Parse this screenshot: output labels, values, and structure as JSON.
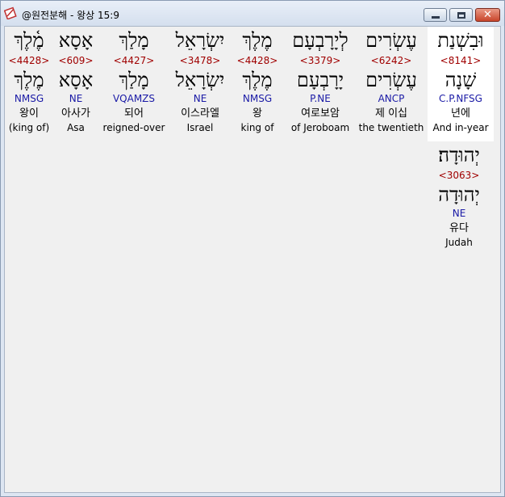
{
  "window": {
    "title": "@원전분해 - 왕상 15:9",
    "icon": "bible-app-icon"
  },
  "words": [
    {
      "surface": "מֶ֫לֶךְ",
      "strong": "<4428>",
      "lemma": "מֶלֶךְ",
      "parse": "NMSG",
      "korean": "왕이",
      "english": "(king of)"
    },
    {
      "surface": "אָסָא",
      "strong": "<609>",
      "lemma": "אָסָא",
      "parse": "NE",
      "korean": "아사가",
      "english": "Asa"
    },
    {
      "surface": "מָלַךְ",
      "strong": "<4427>",
      "lemma": "מָלַךְ",
      "parse": "VQAMZS",
      "korean": "되어",
      "english": "reigned-over"
    },
    {
      "surface": "יִשְׂרָאֵל",
      "strong": "<3478>",
      "lemma": "יִשְׂרָאֵל",
      "parse": "NE",
      "korean": "이스라엘",
      "english": "Israel"
    },
    {
      "surface": "מֶלֶךְ",
      "strong": "<4428>",
      "lemma": "מֶלֶךְ",
      "parse": "NMSG",
      "korean": "왕",
      "english": "king of"
    },
    {
      "surface": "לְיָרָבְעָם",
      "strong": "<3379>",
      "lemma": "יָרָבְעָם",
      "parse": "P.NE",
      "korean": "여로보암",
      "english": "of Jeroboam"
    },
    {
      "surface": "עֶשְׂרִים",
      "strong": "<6242>",
      "lemma": "עֶשְׂרִים",
      "parse": "ANCP",
      "korean": "제 이십",
      "english": "the twentieth"
    },
    {
      "surface": "וּבִשְׁנַת",
      "strong": "<8141>",
      "lemma": "שָׁנָה",
      "parse": "C.P.NFSG",
      "korean": "년에",
      "english": "And in-year"
    },
    {
      "surface": "יְהוּדָה׃",
      "strong": "<3063>",
      "lemma": "יְהוּדָה",
      "parse": "NE",
      "korean": "유다",
      "english": "Judah"
    }
  ]
}
